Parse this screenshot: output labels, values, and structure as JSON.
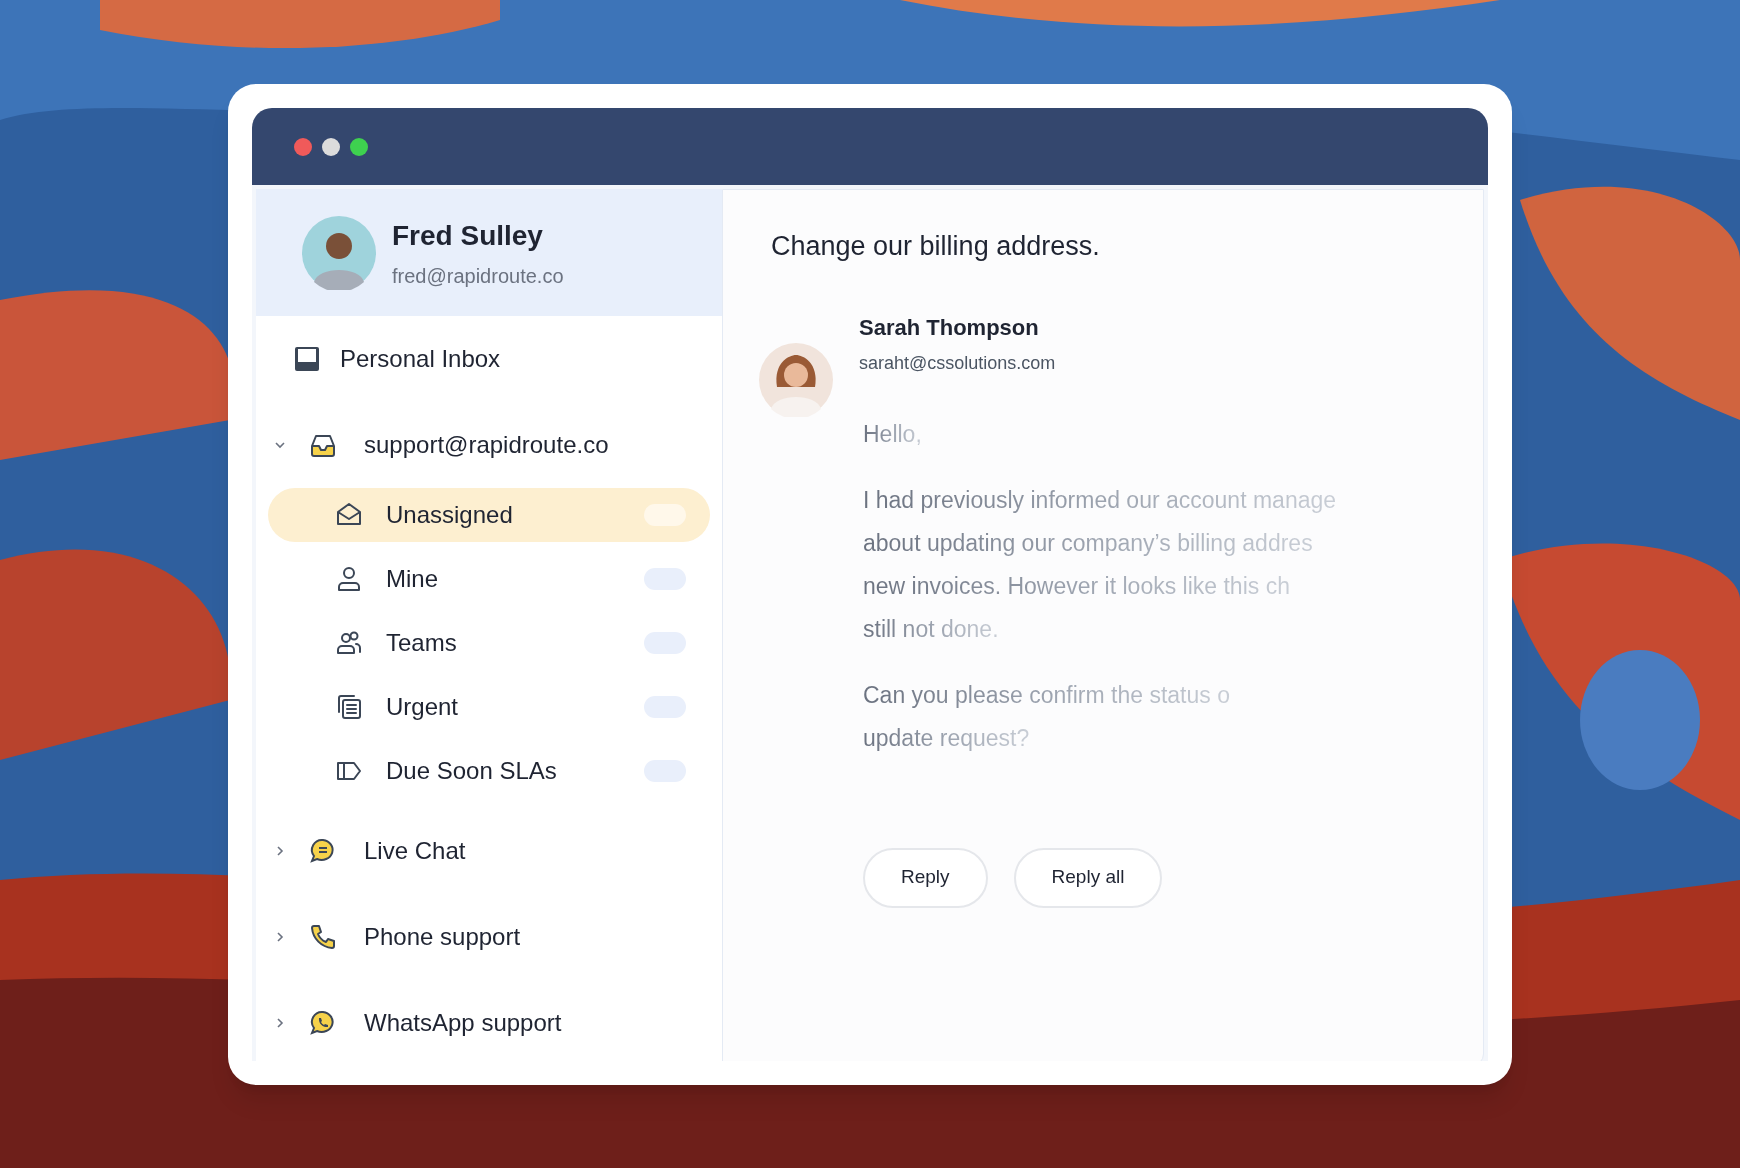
{
  "window": {
    "controls": [
      {
        "color": "#f05a5a"
      },
      {
        "color": "#dcdcdc"
      },
      {
        "color": "#3ed14f"
      }
    ]
  },
  "profile": {
    "name": "Fred Sulley",
    "email": "fred@rapidroute.co"
  },
  "sidebar": {
    "items": [
      {
        "label": "Personal Inbox",
        "kind": "link"
      },
      {
        "label": "support@rapidroute.co",
        "kind": "group",
        "expanded": true,
        "children": [
          {
            "label": "Unassigned",
            "selected": true
          },
          {
            "label": "Mine",
            "selected": false
          },
          {
            "label": "Teams",
            "selected": false
          },
          {
            "label": "Urgent",
            "selected": false
          },
          {
            "label": "Due Soon SLAs",
            "selected": false
          }
        ]
      },
      {
        "label": "Live Chat",
        "kind": "group",
        "expanded": false
      },
      {
        "label": "Phone support",
        "kind": "group",
        "expanded": false
      },
      {
        "label": "WhatsApp support",
        "kind": "group",
        "expanded": false
      }
    ]
  },
  "message": {
    "subject": "Change our billing address.",
    "sender": {
      "name": "Sarah Thompson",
      "email": "saraht@cssolutions.com"
    },
    "body": [
      [
        "Hello,"
      ],
      [
        "I had previously informed our account manage",
        "about updating our company’s billing addres",
        "new invoices. However it looks like this ch",
        "still not done."
      ],
      [
        "Can you please confirm the status o",
        "update request?"
      ]
    ],
    "buttons": [
      "Reply",
      "Reply all"
    ]
  }
}
